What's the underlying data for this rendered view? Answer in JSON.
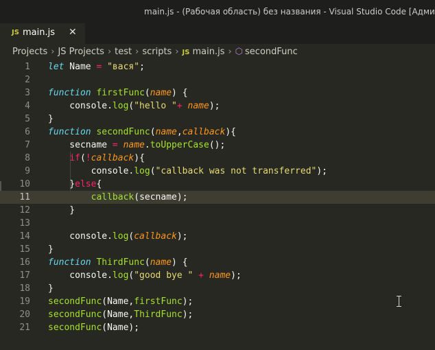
{
  "window": {
    "title": "main.js - (Рабочая область) без названия - Visual Studio Code [Администратор]"
  },
  "tab": {
    "icon_label": "JS",
    "name": "main.js",
    "close_glyph": "✕"
  },
  "breadcrumb": {
    "items": [
      "Projects",
      "JS Projects",
      "test",
      "scripts",
      "main.js",
      "secondFunc"
    ],
    "separator": "›",
    "file_icon_label": "JS",
    "symbol_icon": "⬡"
  },
  "editor": {
    "active_line": 11,
    "colors": {
      "background": "#272822",
      "keyword": "#66d9ef",
      "function": "#a6e22e",
      "string": "#e6db74",
      "operator": "#f92672",
      "parameter": "#fd971f"
    },
    "lines": [
      {
        "n": "1",
        "tokens": [
          [
            "kw",
            "let"
          ],
          [
            "t",
            " Name "
          ],
          [
            "op",
            "="
          ],
          [
            "t",
            " "
          ],
          [
            "str",
            "\"вася\""
          ],
          [
            "t",
            ";"
          ]
        ]
      },
      {
        "n": "2",
        "tokens": []
      },
      {
        "n": "3",
        "tokens": [
          [
            "kw",
            "function"
          ],
          [
            "t",
            " "
          ],
          [
            "fn",
            "firstFunc"
          ],
          [
            "t",
            "("
          ],
          [
            "prm",
            "name"
          ],
          [
            "t",
            ") {"
          ]
        ]
      },
      {
        "n": "4",
        "tokens": [
          [
            "t",
            "    console."
          ],
          [
            "fn",
            "log"
          ],
          [
            "t",
            "("
          ],
          [
            "str",
            "\"hello \""
          ],
          [
            "op",
            "+"
          ],
          [
            "t",
            " "
          ],
          [
            "prm",
            "name"
          ],
          [
            "t",
            ");"
          ]
        ]
      },
      {
        "n": "5",
        "tokens": [
          [
            "t",
            "}"
          ]
        ]
      },
      {
        "n": "6",
        "tokens": [
          [
            "kw",
            "function"
          ],
          [
            "t",
            " "
          ],
          [
            "fn",
            "secondFunc"
          ],
          [
            "t",
            "("
          ],
          [
            "prm",
            "name"
          ],
          [
            "t",
            ","
          ],
          [
            "prm",
            "callback"
          ],
          [
            "t",
            "){"
          ]
        ]
      },
      {
        "n": "7",
        "tokens": [
          [
            "t",
            "    secname "
          ],
          [
            "op",
            "="
          ],
          [
            "t",
            " "
          ],
          [
            "prm",
            "name"
          ],
          [
            "t",
            "."
          ],
          [
            "fn",
            "toUpperCase"
          ],
          [
            "t",
            "();"
          ]
        ]
      },
      {
        "n": "8",
        "tokens": [
          [
            "t",
            "    "
          ],
          [
            "op",
            "if"
          ],
          [
            "t",
            "("
          ],
          [
            "op",
            "!"
          ],
          [
            "prm",
            "callback"
          ],
          [
            "t",
            "){"
          ]
        ]
      },
      {
        "n": "9",
        "tokens": [
          [
            "t",
            "        console."
          ],
          [
            "fn",
            "log"
          ],
          [
            "t",
            "("
          ],
          [
            "str",
            "\"callback was not transferred\""
          ],
          [
            "t",
            ");"
          ]
        ]
      },
      {
        "n": "10",
        "tokens": [
          [
            "t",
            "    }"
          ],
          [
            "op",
            "else"
          ],
          [
            "t",
            "{"
          ]
        ]
      },
      {
        "n": "11",
        "tokens": [
          [
            "t",
            "        "
          ],
          [
            "fn",
            "callback"
          ],
          [
            "t",
            "(secname);"
          ]
        ]
      },
      {
        "n": "12",
        "tokens": [
          [
            "t",
            "    }"
          ]
        ]
      },
      {
        "n": "13",
        "tokens": []
      },
      {
        "n": "14",
        "tokens": [
          [
            "t",
            "    console."
          ],
          [
            "fn",
            "log"
          ],
          [
            "t",
            "("
          ],
          [
            "prm",
            "callback"
          ],
          [
            "t",
            ");"
          ]
        ]
      },
      {
        "n": "15",
        "tokens": [
          [
            "t",
            "}"
          ]
        ]
      },
      {
        "n": "16",
        "tokens": [
          [
            "kw",
            "function"
          ],
          [
            "t",
            " "
          ],
          [
            "fn",
            "ThirdFunc"
          ],
          [
            "t",
            "("
          ],
          [
            "prm",
            "name"
          ],
          [
            "t",
            ") {"
          ]
        ]
      },
      {
        "n": "17",
        "tokens": [
          [
            "t",
            "    console."
          ],
          [
            "fn",
            "log"
          ],
          [
            "t",
            "("
          ],
          [
            "str",
            "\"good bye \""
          ],
          [
            "t",
            " "
          ],
          [
            "op",
            "+"
          ],
          [
            "t",
            " "
          ],
          [
            "prm",
            "name"
          ],
          [
            "t",
            ");"
          ]
        ]
      },
      {
        "n": "18",
        "tokens": [
          [
            "t",
            "}"
          ]
        ]
      },
      {
        "n": "19",
        "tokens": [
          [
            "fn",
            "secondFunc"
          ],
          [
            "t",
            "(Name,"
          ],
          [
            "fn",
            "firstFunc"
          ],
          [
            "t",
            ");"
          ]
        ]
      },
      {
        "n": "20",
        "tokens": [
          [
            "fn",
            "secondFunc"
          ],
          [
            "t",
            "(Name,"
          ],
          [
            "fn",
            "ThirdFunc"
          ],
          [
            "t",
            ");"
          ]
        ]
      },
      {
        "n": "21",
        "tokens": [
          [
            "fn",
            "secondFunc"
          ],
          [
            "t",
            "(Name);"
          ]
        ]
      }
    ]
  },
  "mouse_cursor_icon": "text-ibeam-cursor"
}
